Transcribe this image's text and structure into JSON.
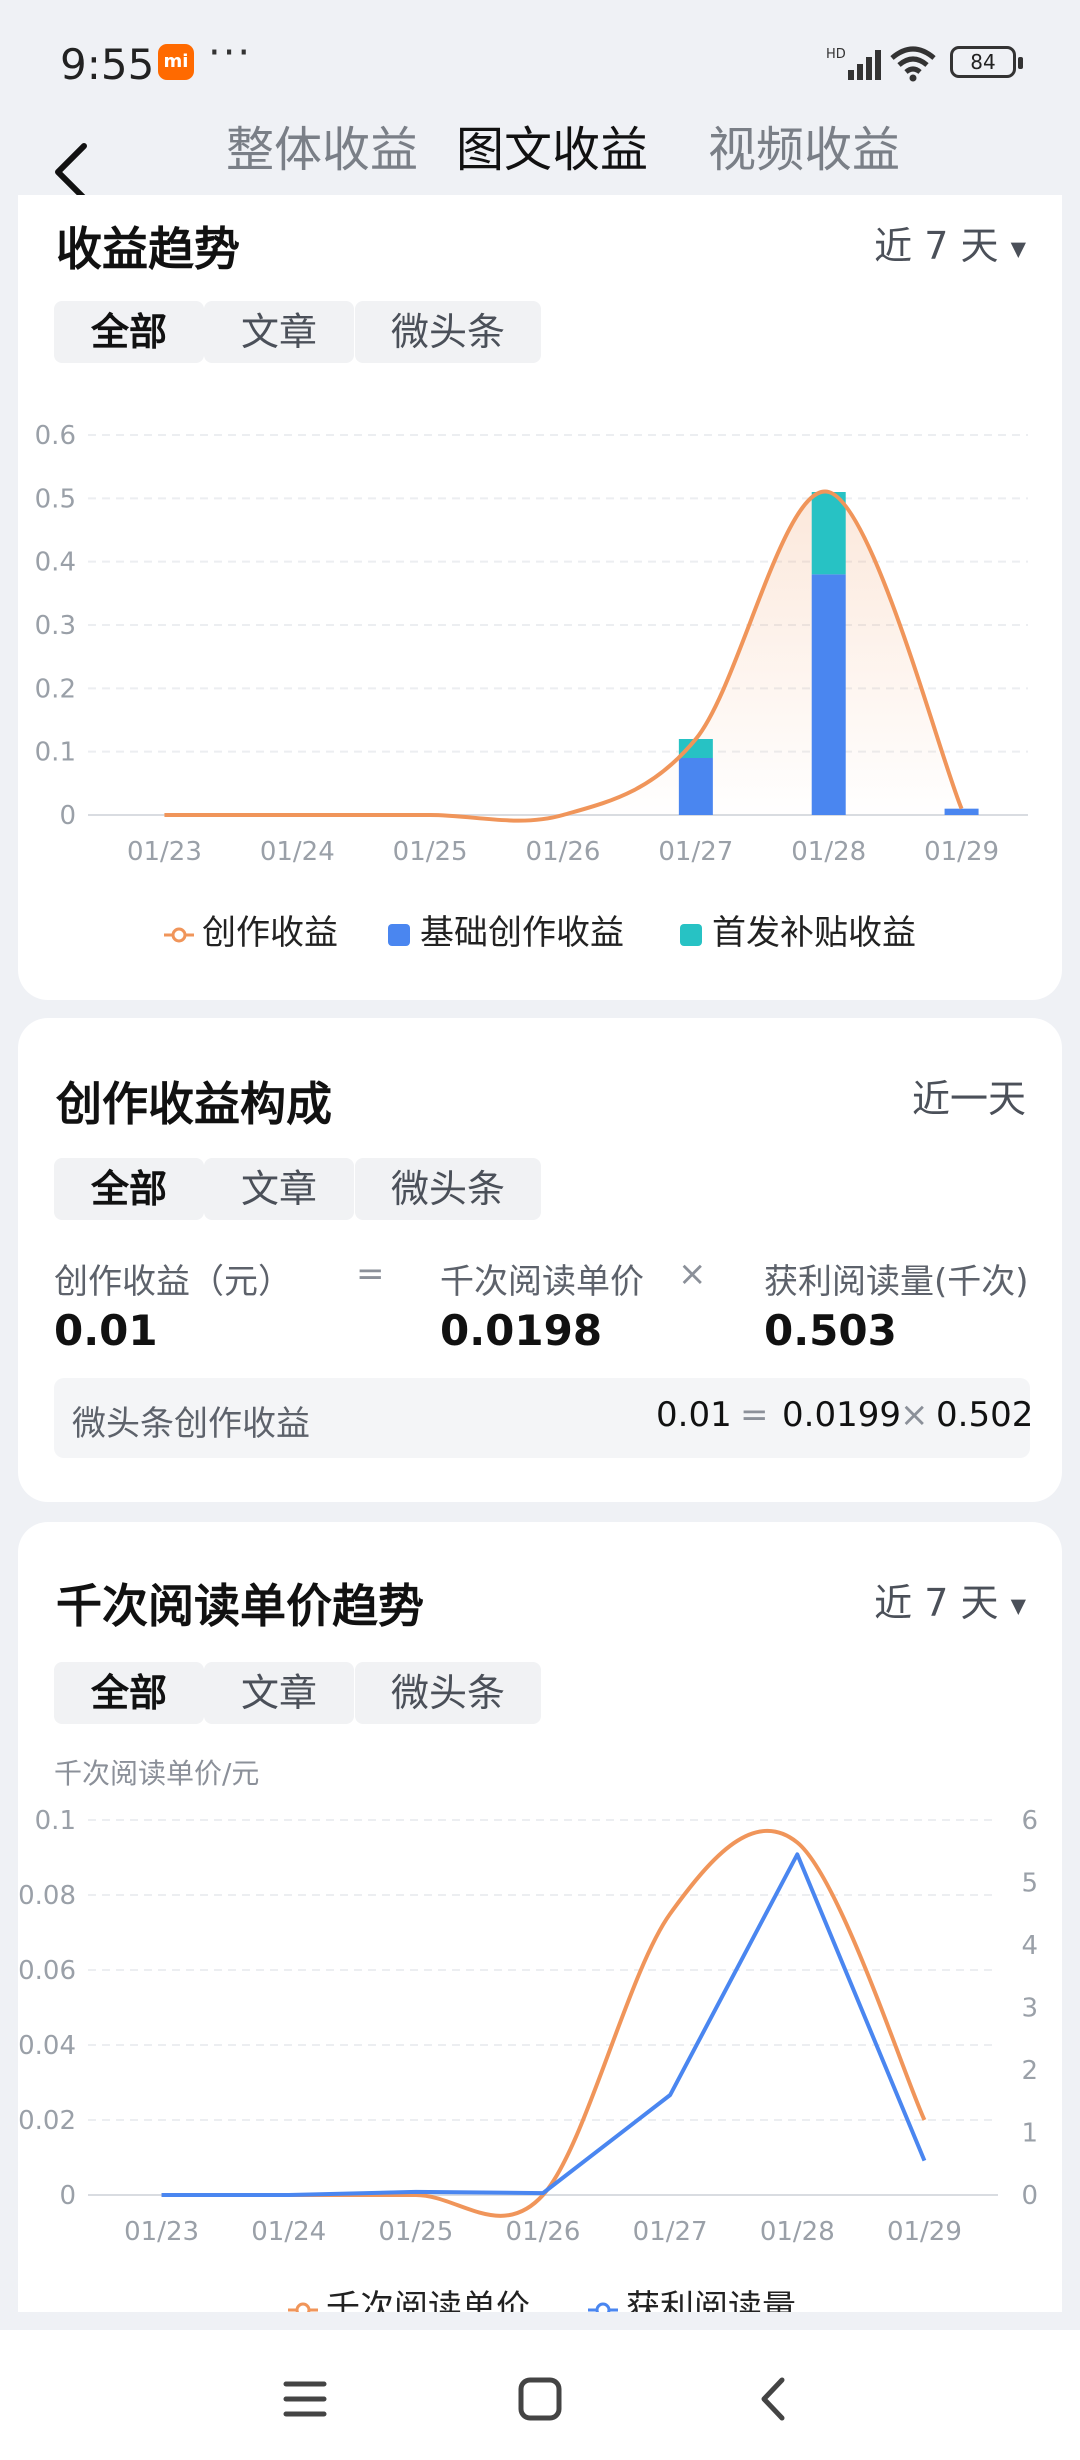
{
  "status": {
    "time": "9:55",
    "battery": "84",
    "network": "HD"
  },
  "header": {
    "tabs": [
      "整体收益",
      "图文收益",
      "视频收益"
    ],
    "active_tab": 1
  },
  "trend_card": {
    "title": "收益趋势",
    "range": "近 7 天",
    "filters": [
      "全部",
      "文章",
      "微头条"
    ],
    "legend": [
      "创作收益",
      "基础创作收益",
      "首发补贴收益"
    ]
  },
  "composition_card": {
    "title": "创作收益构成",
    "range": "近一天",
    "filters": [
      "全部",
      "文章",
      "微头条"
    ],
    "labels": [
      "创作收益（元）",
      "千次阅读单价",
      "获利阅读量(千次)"
    ],
    "values": [
      "0.01",
      "0.0198",
      "0.503"
    ],
    "ops": [
      "=",
      "×"
    ],
    "sub_row": {
      "label": "微头条创作收益",
      "v1": "0.01",
      "op1": "=",
      "v2": "0.0199",
      "op2": "×",
      "v3": "0.502"
    }
  },
  "price_card": {
    "title": "千次阅读单价趋势",
    "range": "近 7 天",
    "filters": [
      "全部",
      "文章",
      "微头条"
    ],
    "y_label": "千次阅读单价/元",
    "legend": [
      "千次阅读单价",
      "获利阅读量"
    ]
  },
  "colors": {
    "orange": "#f0955a",
    "blue": "#4a86f0",
    "teal": "#27c2c4"
  },
  "chart_data": [
    {
      "type": "bar",
      "categories": [
        "01/23",
        "01/24",
        "01/25",
        "01/26",
        "01/27",
        "01/28",
        "01/29"
      ],
      "ylim": [
        0,
        0.6
      ],
      "yticks": [
        "0",
        "0.1",
        "0.2",
        "0.3",
        "0.4",
        "0.5",
        "0.6"
      ],
      "series": [
        {
          "name": "基础创作收益",
          "values": [
            0,
            0,
            0,
            0,
            0.09,
            0.38,
            0.01
          ]
        },
        {
          "name": "首发补贴收益",
          "values": [
            0,
            0,
            0,
            0,
            0.03,
            0.13,
            0
          ]
        },
        {
          "name": "创作收益",
          "values": [
            0,
            0,
            0,
            0,
            0.12,
            0.51,
            0.01
          ]
        }
      ]
    },
    {
      "type": "line",
      "categories": [
        "01/23",
        "01/24",
        "01/25",
        "01/26",
        "01/27",
        "01/28",
        "01/29"
      ],
      "ylim": [
        0,
        0.1
      ],
      "yticks": [
        "0",
        "0.02",
        "0.04",
        "0.06",
        "0.08",
        "0.1"
      ],
      "y2lim": [
        0,
        6
      ],
      "y2ticks": [
        "0",
        "1",
        "2",
        "3",
        "4",
        "5",
        "6"
      ],
      "series": [
        {
          "name": "千次阅读单价",
          "axis": "left",
          "values": [
            0,
            0,
            0,
            0,
            0.075,
            0.094,
            0.02
          ]
        },
        {
          "name": "获利阅读量",
          "axis": "right",
          "values": [
            0,
            0,
            0.05,
            0.03,
            1.6,
            5.45,
            0.55
          ]
        }
      ]
    }
  ]
}
